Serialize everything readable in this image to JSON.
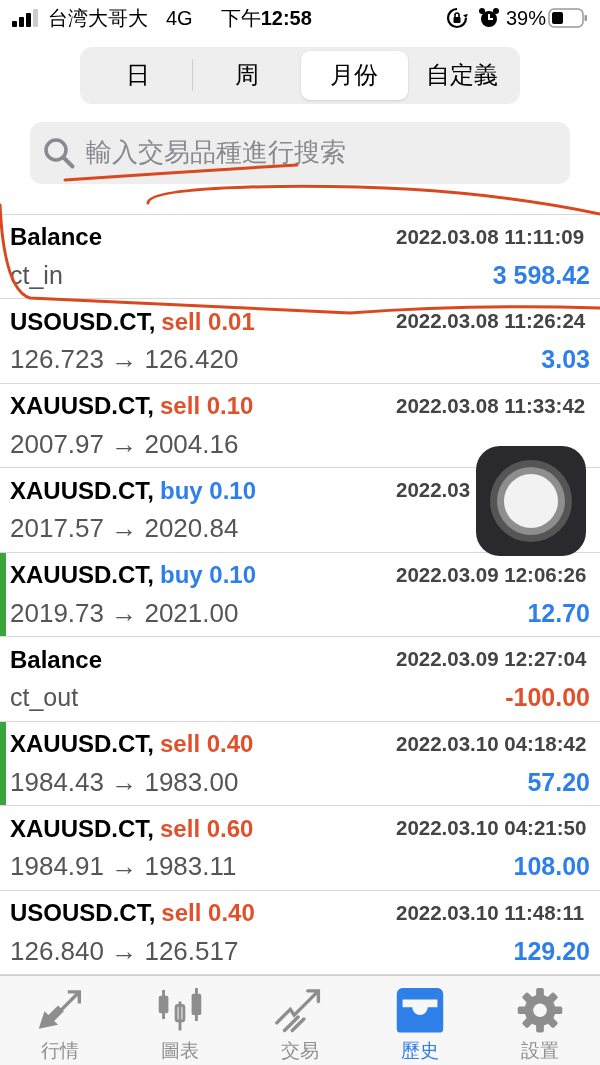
{
  "status_bar": {
    "carrier": "台湾大哥大",
    "network": "4G",
    "time_prefix": "下午",
    "time": "12:58",
    "battery": "39%"
  },
  "period_tabs": [
    {
      "label": "日",
      "selected": false
    },
    {
      "label": "周",
      "selected": false
    },
    {
      "label": "月份",
      "selected": true
    },
    {
      "label": "自定義",
      "selected": false
    }
  ],
  "search": {
    "placeholder": "輸入交易品種進行搜索"
  },
  "history": [
    {
      "kind": "balance",
      "title": "Balance",
      "time": "2022.03.08 11:11:09",
      "comment": "ct_in",
      "amount": "3 598.42",
      "loss": false,
      "marked": false
    },
    {
      "kind": "sell",
      "symbol": "USOUSD.CT,",
      "order": "sell 0.01",
      "time": "2022.03.08 11:26:24",
      "prices": "126.723 → 126.420",
      "amount": "3.03",
      "loss": false,
      "marked": false
    },
    {
      "kind": "sell",
      "symbol": "XAUUSD.CT,",
      "order": "sell 0.10",
      "time": "2022.03.08 11:33:42",
      "prices": "2007.97 → 2004.16",
      "marked": false
    },
    {
      "kind": "buy",
      "symbol": "XAUUSD.CT,",
      "order": "buy 0.10",
      "time": "2022.03",
      "prices": "2017.57 → 2020.84",
      "marked": false
    },
    {
      "kind": "buy",
      "symbol": "XAUUSD.CT,",
      "order": "buy 0.10",
      "time": "2022.03.09 12:06:26",
      "prices": "2019.73 → 2021.00",
      "amount": "12.70",
      "loss": false,
      "marked": true
    },
    {
      "kind": "balance",
      "title": "Balance",
      "time": "2022.03.09 12:27:04",
      "comment": "ct_out",
      "amount": "-100.00",
      "loss": true,
      "marked": false
    },
    {
      "kind": "sell",
      "symbol": "XAUUSD.CT,",
      "order": "sell 0.40",
      "time": "2022.03.10 04:18:42",
      "prices": "1984.43 → 1983.00",
      "amount": "57.20",
      "loss": false,
      "marked": true
    },
    {
      "kind": "sell",
      "symbol": "XAUUSD.CT,",
      "order": "sell 0.60",
      "time": "2022.03.10 04:21:50",
      "prices": "1984.91 → 1983.11",
      "amount": "108.00",
      "loss": false,
      "marked": false
    },
    {
      "kind": "sell",
      "symbol": "USOUSD.CT,",
      "order": "sell 0.40",
      "time": "2022.03.10 11:48:11",
      "prices": "126.840 → 126.517",
      "amount": "129.20",
      "loss": false,
      "marked": false
    }
  ],
  "tab_bar": [
    {
      "kind": "quotes",
      "label": "行情",
      "selected": false
    },
    {
      "kind": "chart",
      "label": "圖表",
      "selected": false
    },
    {
      "kind": "trade",
      "label": "交易",
      "selected": false
    },
    {
      "kind": "history",
      "label": "歷史",
      "selected": true
    },
    {
      "kind": "settings",
      "label": "設置",
      "selected": false
    }
  ]
}
